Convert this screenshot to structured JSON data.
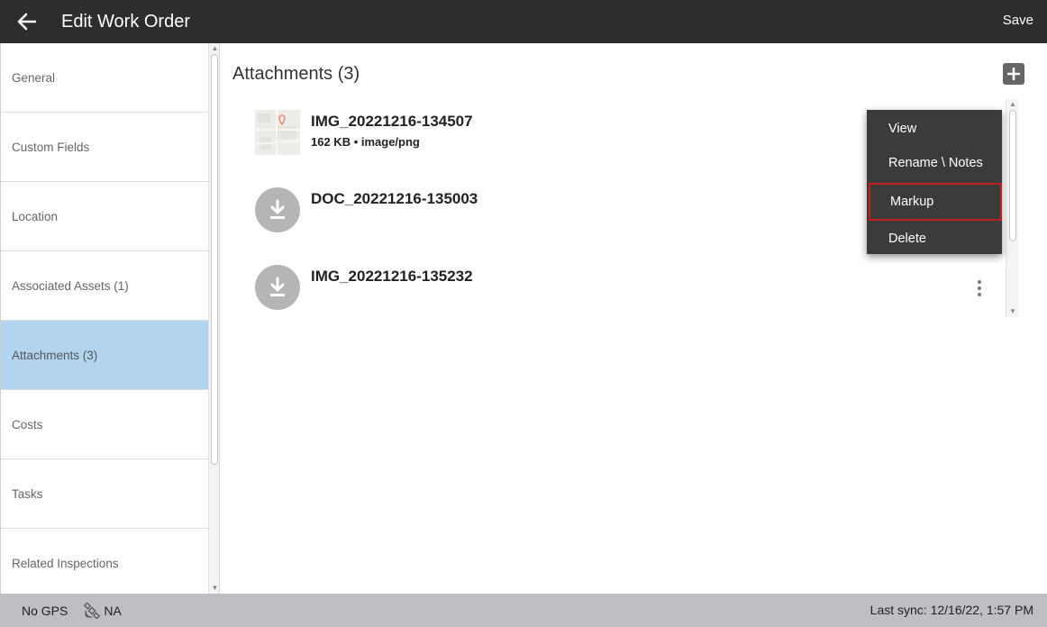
{
  "header": {
    "title": "Edit Work Order",
    "save_label": "Save",
    "back_icon": "arrow-left-icon"
  },
  "sidebar": {
    "items": [
      {
        "label": "General"
      },
      {
        "label": "Custom Fields"
      },
      {
        "label": "Location"
      },
      {
        "label": "Associated Assets (1)"
      },
      {
        "label": "Attachments (3)",
        "active": true
      },
      {
        "label": "Costs"
      },
      {
        "label": "Tasks"
      },
      {
        "label": "Related Inspections"
      }
    ]
  },
  "main": {
    "title": "Attachments (3)",
    "add_icon": "plus-square-icon",
    "attachments": [
      {
        "name": "IMG_20221216-134507",
        "meta": "162 KB • image/png",
        "icon": "image-thumbnail"
      },
      {
        "name": "DOC_20221216-135003",
        "meta": "",
        "icon": "download-icon"
      },
      {
        "name": "IMG_20221216-135232",
        "meta": "",
        "icon": "download-icon"
      }
    ]
  },
  "context_menu": {
    "items": [
      {
        "label": "View"
      },
      {
        "label": "Rename \\ Notes"
      },
      {
        "label": "Markup",
        "highlighted": true
      },
      {
        "label": "Delete"
      }
    ]
  },
  "footer": {
    "gps": "No GPS",
    "satellite_status": "NA",
    "last_sync": "Last sync: 12/16/22, 1:57 PM"
  },
  "colors": {
    "header_bg": "#2b2d2f",
    "active_item_bg": "#b2d4ef",
    "menu_bg": "#3b3b3b",
    "menu_highlight_border": "#c0201f",
    "footer_bg": "#bdbfc4"
  }
}
